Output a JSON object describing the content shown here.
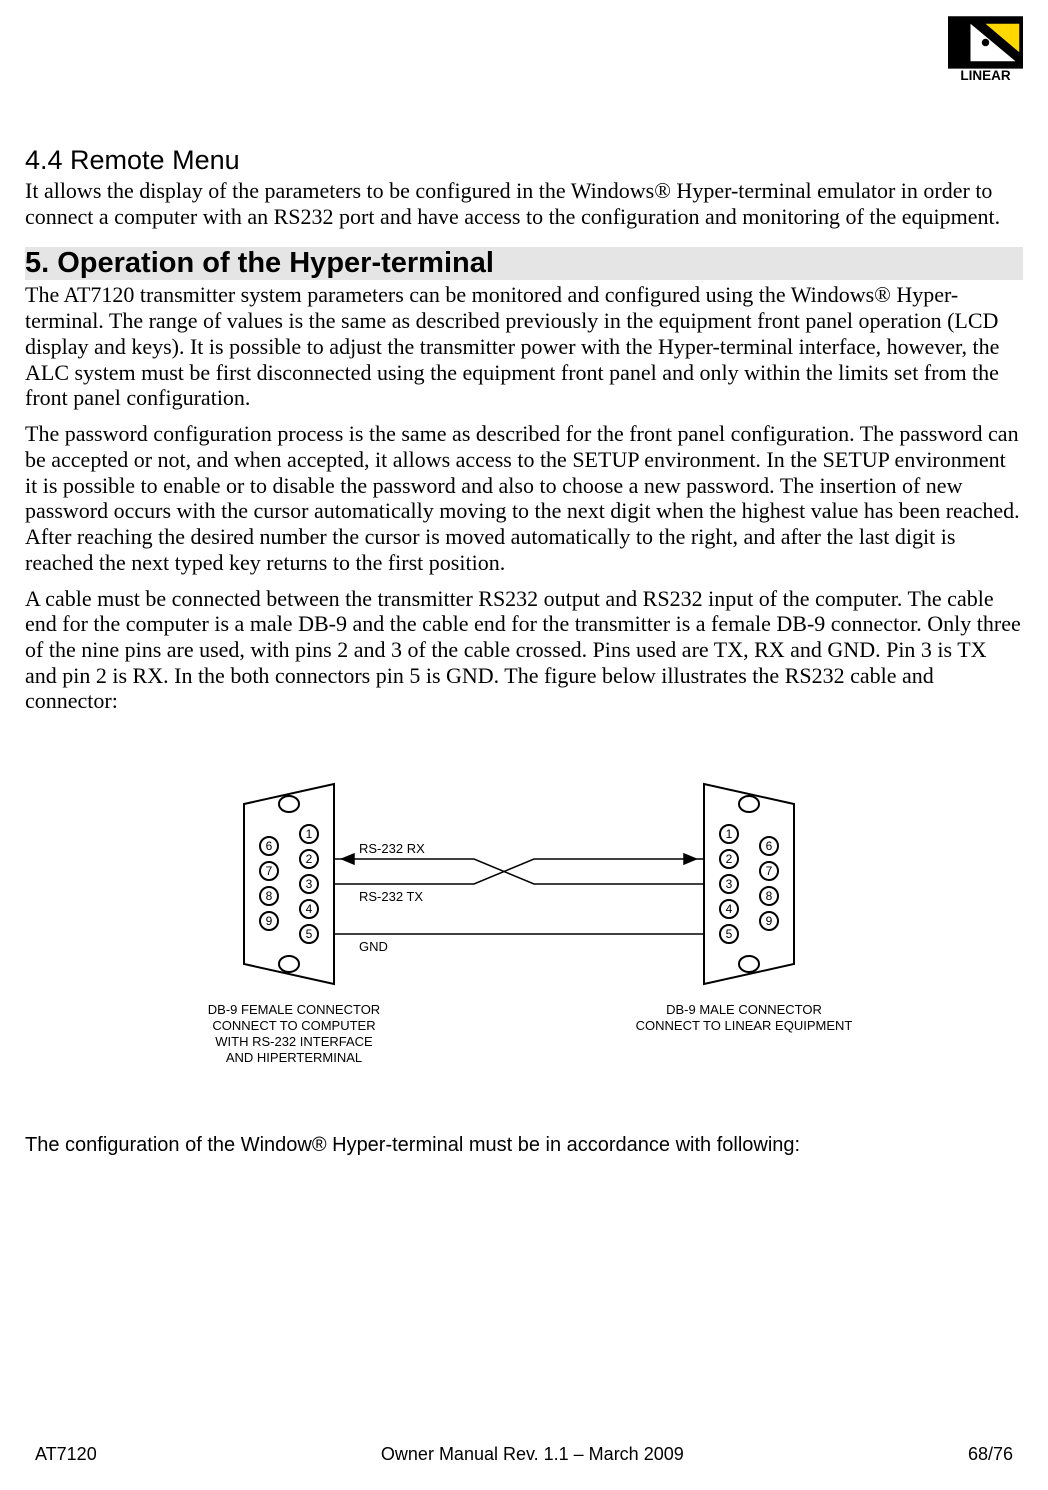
{
  "logo": {
    "brand": "LINEAR"
  },
  "section44": {
    "heading": "4.4 Remote Menu",
    "p1": "It allows the display of the parameters to be configured in the Windows® Hyper-terminal emulator in order to connect a computer with an RS232 port and have access to the configuration and monitoring of the equipment."
  },
  "section5": {
    "heading": "5. Operation of the Hyper-terminal",
    "p1": "The AT7120 transmitter system parameters can be monitored and configured using the Windows® Hyper-terminal. The range of values is the same as described previously in the equipment front panel operation (LCD display and keys). It is possible to adjust the transmitter power with the Hyper-terminal interface, however, the ALC system must be first disconnected using the equipment front panel and only within the limits set from the front panel configuration.",
    "p2": "The password configuration process is the same as described for the front panel configuration. The password can be accepted or not, and when accepted, it allows access to the SETUP environment. In the SETUP environment it is possible to enable or to disable the password and also to choose a new password. The insertion of new password occurs with the cursor automatically moving to the next digit when the highest value has been reached. After reaching the desired number the cursor is moved automatically to the right, and after the last digit is reached the next typed key returns to the first position.",
    "p3": "A cable must be connected between the transmitter RS232 output and RS232 input of the computer. The cable end for the computer is a male DB-9 and the cable end for the transmitter is a female DB-9 connector. Only three of the nine pins are used, with pins 2 and 3 of the cable crossed. Pins used are TX, RX and GND. Pin 3 is TX and pin 2 is RX. In the both connectors pin 5 is GND. The figure below illustrates the RS232 cable and connector:"
  },
  "figure": {
    "left_caption_l1": "DB-9 FEMALE CONNECTOR",
    "left_caption_l2": "CONNECT TO COMPUTER",
    "left_caption_l3": "WITH RS-232 INTERFACE",
    "left_caption_l4": "AND HIPERTERMINAL",
    "right_caption_l1": "DB-9 MALE CONNECTOR",
    "right_caption_l2": "CONNECT TO LINEAR EQUIPMENT",
    "wire_rx": "RS-232 RX",
    "wire_tx": "RS-232 TX",
    "wire_gnd": "GND",
    "pins_inner": [
      "1",
      "2",
      "3",
      "4",
      "5"
    ],
    "pins_outer": [
      "6",
      "7",
      "8",
      "9"
    ]
  },
  "post_figure": "The configuration of the Window® Hyper-terminal must be in accordance with following:",
  "footer": {
    "model": "AT7120",
    "center": "Owner Manual Rev. 1.1 – March 2009",
    "page": "68/76"
  }
}
